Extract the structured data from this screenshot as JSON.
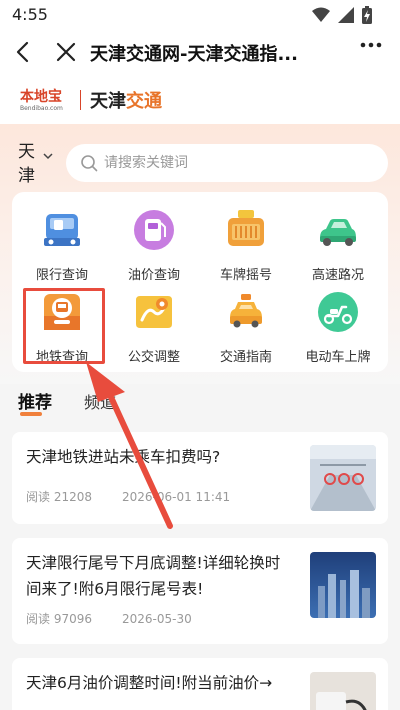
{
  "status_bar": {
    "time": "4:55"
  },
  "nav": {
    "title": "天津交通网-天津交通指..."
  },
  "brand": {
    "logo_text": "本地宝",
    "logo_sub": "Bendibao.com",
    "name_part1": "天津",
    "name_part2": "交通"
  },
  "location": {
    "city": "天津"
  },
  "search": {
    "placeholder": "请搜索关键词",
    "value": ""
  },
  "services": [
    {
      "label": "限行查询",
      "icon": "car-restriction-icon"
    },
    {
      "label": "油价查询",
      "icon": "fuel-price-icon"
    },
    {
      "label": "车牌摇号",
      "icon": "license-plate-icon"
    },
    {
      "label": "高速路况",
      "icon": "highway-car-icon"
    },
    {
      "label": "地铁查询",
      "icon": "metro-icon"
    },
    {
      "label": "公交调整",
      "icon": "bus-route-icon"
    },
    {
      "label": "交通指南",
      "icon": "taxi-guide-icon"
    },
    {
      "label": "电动车上牌",
      "icon": "scooter-icon"
    }
  ],
  "tabs": {
    "recommend": "推荐",
    "channel": "频道"
  },
  "articles": [
    {
      "title": "天津地铁进站未乘车扣费吗?",
      "reads": "阅读 21208",
      "date": "2026-06-01 11:41"
    },
    {
      "title": "天津限行尾号下月底调整!详细轮换时间来了!附6月限行尾号表!",
      "reads": "阅读 97096",
      "date": "2026-05-30"
    },
    {
      "title": "天津6月油价调整时间!附当前油价→",
      "reads": "",
      "date": ""
    }
  ],
  "colors": {
    "accent": "#f0803c",
    "highlight_border": "#e84c3d",
    "brand_red": "#d8452a"
  }
}
